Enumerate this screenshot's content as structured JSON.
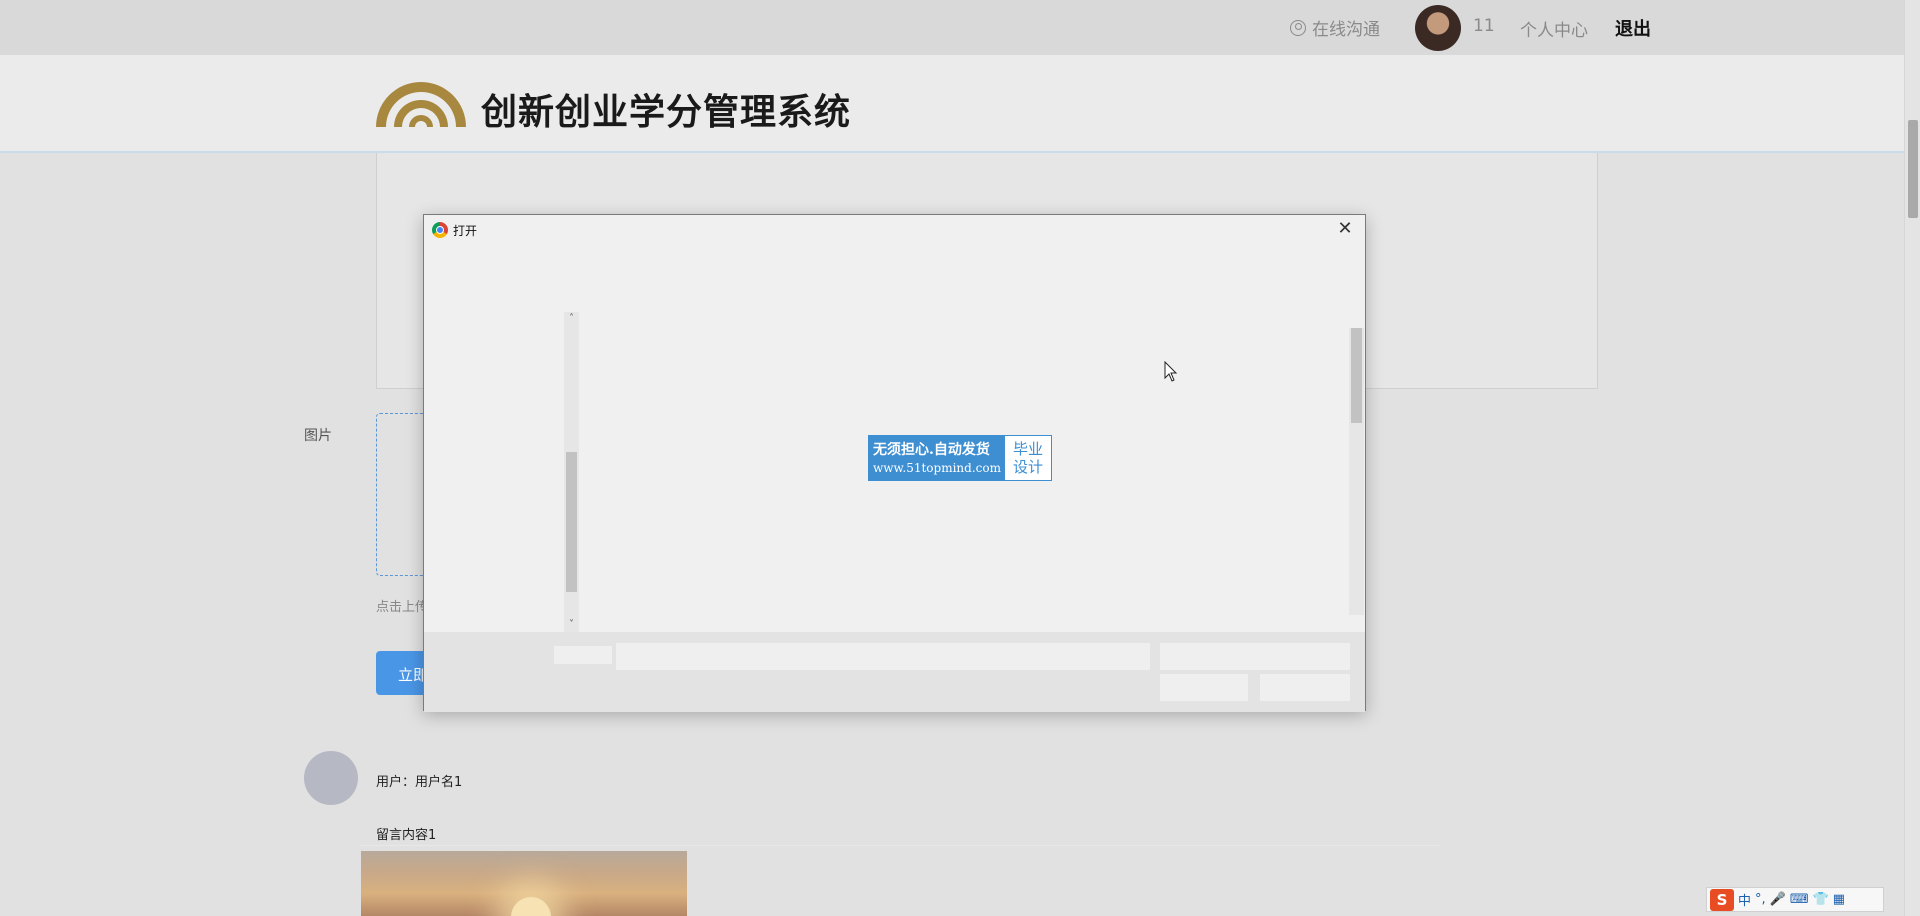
{
  "topbar": {
    "online_chat": "在线沟通",
    "username": "11",
    "personal_center": "个人中心",
    "logout": "退出"
  },
  "header": {
    "system_title": "创新创业学分管理系统"
  },
  "form": {
    "image_label": "图片",
    "upload_tip": "点击上传",
    "submit_label": "立即"
  },
  "comment": {
    "user_label": "用户：",
    "user_name": "用户名1",
    "content": "留言内容1"
  },
  "dialog": {
    "title": "打开",
    "close_glyph": "✕",
    "scroll_up": "˄",
    "scroll_down": "˅",
    "watermark": {
      "line1": "无须担心.自动发货",
      "line2": "www.51topmind.com",
      "right_line1": "毕业",
      "right_line2": "设计"
    }
  },
  "ime": {
    "logo": "S",
    "mode": "中",
    "punct": "°,",
    "mic": "🎤",
    "keyboard": "⌨",
    "skin": "👕",
    "grid": "▦"
  },
  "colors": {
    "accent": "#4a96e6",
    "logo_gold": "#a8883f",
    "watermark_blue": "#3e8ed2"
  }
}
